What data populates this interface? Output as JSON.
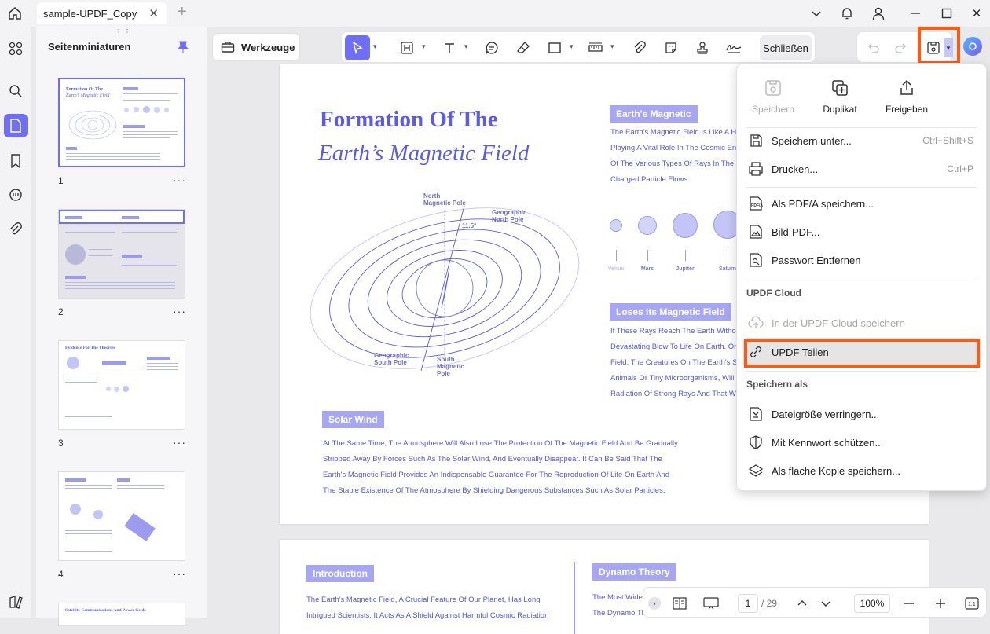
{
  "tab": {
    "title": "sample-UPDF_Copy"
  },
  "sidebar": {
    "title": "Seitenminiaturen",
    "pages": [
      "1",
      "2",
      "3",
      "4"
    ],
    "more": "..."
  },
  "toolbar": {
    "werkzeuge": "Werkzeuge",
    "close": "Schließen"
  },
  "document": {
    "title_line1": "Formation Of The",
    "title_line2": "Earth’s Magnetic Field",
    "sec1_head": "Earth's Magnetic",
    "sec1_lines": [
      "The Earth's Magnetic Field Is Like A Hu",
      "Playing A Vital Role In The Cosmic Env",
      "Of The Various Types Of Rays In The U",
      "Charged Particle Flows."
    ],
    "planets": [
      "Venus",
      "Mars",
      "Jupiter",
      "Saturn"
    ],
    "sec2_head": "Loses Its Magnetic Field",
    "sec2_lines": [
      "If These Rays Reach The Earth Without",
      "Devastating Blow To Life On Earth. On",
      "Field, The Creatures On The Earth's S",
      "Animals Or Tiny Microorganisms, Will B",
      "Radiation Of Strong Rays And That Wo"
    ],
    "diagram": {
      "north_mag": "North\nMagnetic Pole",
      "geo_north": "Geographic\nNorth Pole",
      "angle": "11.5°",
      "geo_south": "Geographic\nSouth Pole",
      "south_mag": "South\nMagnetic\nPole"
    },
    "solar_head": "Solar Wind",
    "solar_lines": [
      "At The Same Time, The Atmosphere Will Also Lose The Protection Of The Magnetic Field And Be Gradually",
      "Stripped Away By Forces Such As The Solar Wind, And Eventually Disappear. It Can Be Said That The",
      "Earth's Magnetic Field Provides An Indispensable Guarantee For The Reproduction Of Life On Earth And",
      "The Stable Existence Of The Atmosphere By Shielding Dangerous Substances Such As Solar Particles."
    ],
    "page2_intro_head": "Introduction",
    "page2_intro_lines": [
      "The Earth's Magnetic Field, A Crucial Feature Of Our Planet, Has Long",
      "Intrigued Scientists. It Acts As A Shield Against Harmful Cosmic Radiation"
    ],
    "page2_dyn_head": "Dynamo Theory",
    "page2_dyn_lines": [
      "The Most Wide",
      "The Dynamo Th"
    ]
  },
  "menu": {
    "top": [
      {
        "label": "Speichern",
        "icon": "save-icon",
        "disabled": true
      },
      {
        "label": "Duplikat",
        "icon": "duplicate-icon",
        "disabled": false
      },
      {
        "label": "Freigeben",
        "icon": "share-icon",
        "disabled": false
      }
    ],
    "items": [
      {
        "label": "Speichern unter...",
        "shortcut": "Ctrl+Shift+S",
        "icon": "save-as-icon"
      },
      {
        "label": "Drucken...",
        "shortcut": "Ctrl+P",
        "icon": "print-icon"
      },
      {
        "label": "Als PDF/A speichern...",
        "shortcut": "",
        "icon": "pdfa-icon"
      },
      {
        "label": "Bild-PDF...",
        "shortcut": "",
        "icon": "image-pdf-icon"
      },
      {
        "label": "Passwort Entfernen",
        "shortcut": "",
        "icon": "remove-password-icon"
      }
    ],
    "cloud_section": "UPDF Cloud",
    "cloud_items": [
      {
        "label": "In der UPDF Cloud speichern",
        "icon": "cloud-upload-icon",
        "disabled": true
      },
      {
        "label": "UPDF Teilen",
        "icon": "link-icon",
        "disabled": false
      }
    ],
    "save_as_section": "Speichern als",
    "save_as_items": [
      {
        "label": "Dateigröße verringern...",
        "icon": "compress-icon"
      },
      {
        "label": "Mit Kennwort schützen...",
        "icon": "shield-icon"
      },
      {
        "label": "Als flache Kopie speichern...",
        "icon": "layers-icon"
      }
    ]
  },
  "bottom": {
    "page": "1",
    "total": "/ 29",
    "zoom": "100%"
  },
  "colors": {
    "accent": "#6f6ef6",
    "highlight": "#ff5a14",
    "doc_text": "#5858e0"
  }
}
